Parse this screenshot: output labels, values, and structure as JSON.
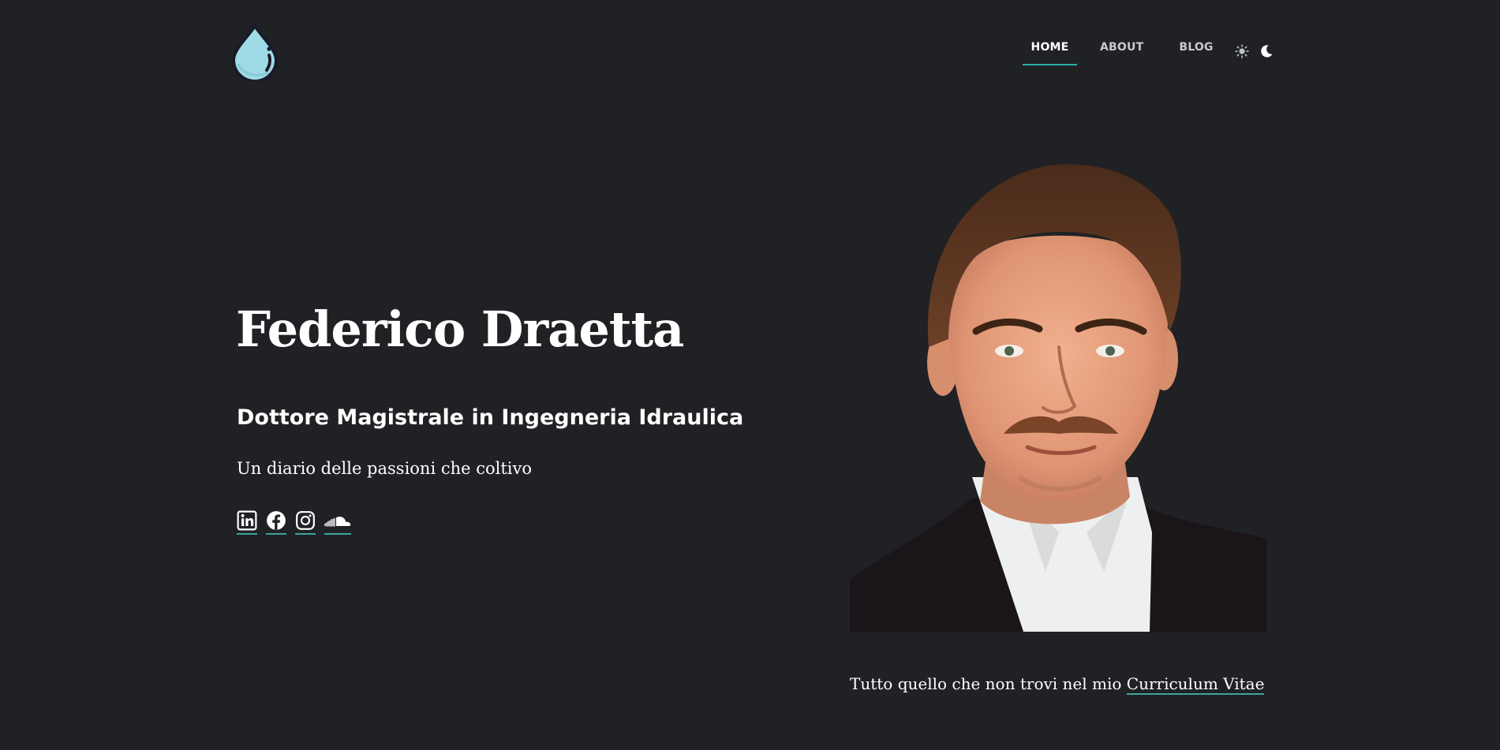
{
  "nav": {
    "home": "HOME",
    "about": "ABOUT",
    "blog": "BLOG"
  },
  "theme": {
    "light_icon": "sun-icon",
    "dark_icon": "moon-icon"
  },
  "hero": {
    "name": "Federico Draetta",
    "role": "Dottore Magistrale in Ingegneria Idraulica",
    "tagline": "Un diario delle passioni che coltivo"
  },
  "social": [
    "linkedin-icon",
    "facebook-icon",
    "instagram-icon",
    "soundcloud-icon"
  ],
  "cv": {
    "prefix": "Tutto quello che non trovi nel mio ",
    "link_label": "Curriculum Vitae"
  },
  "colors": {
    "background": "#202124",
    "accent": "#2ab1a6",
    "logo_fill": "#9edbe6"
  }
}
